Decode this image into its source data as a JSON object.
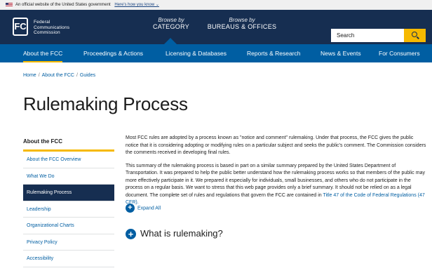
{
  "gov_banner": {
    "text": "An official website of the United States government",
    "link": "Here's how you know ⌄"
  },
  "masthead": {
    "logo_mark": "FC",
    "logo_lines": [
      "Federal",
      "Communications",
      "Commission"
    ],
    "browse_category": {
      "small": "Browse by",
      "big": "CATEGORY"
    },
    "browse_bureaus": {
      "small": "Browse by",
      "big": "BUREAUS & OFFICES"
    },
    "search_placeholder": "Search"
  },
  "nav": [
    {
      "label": "About the FCC",
      "active": true
    },
    {
      "label": "Proceedings & Actions",
      "active": false
    },
    {
      "label": "Licensing & Databases",
      "active": false
    },
    {
      "label": "Reports & Research",
      "active": false
    },
    {
      "label": "News & Events",
      "active": false
    },
    {
      "label": "For Consumers",
      "active": false
    }
  ],
  "breadcrumb": [
    "Home",
    "About the FCC",
    "Guides"
  ],
  "page_title": "Rulemaking Process",
  "sidebar": {
    "heading": "About the FCC",
    "items": [
      {
        "label": "About the FCC Overview",
        "active": false
      },
      {
        "label": "What We Do",
        "active": false
      },
      {
        "label": "Rulemaking Process",
        "active": true
      },
      {
        "label": "Leadership",
        "active": false
      },
      {
        "label": "Organizational Charts",
        "active": false
      },
      {
        "label": "Privacy Policy",
        "active": false
      },
      {
        "label": "Accessibility",
        "active": false
      }
    ]
  },
  "content": {
    "para1": "Most FCC rules are adopted by a process known as \"notice and comment\" rulemaking. Under that process, the FCC gives the public notice that it is considering adopting or modifying rules on a particular subject and seeks the public's comment. The Commission considers the comments received in developing final rules.",
    "para2": "This summary of the rulemaking process is based in part on a similar summary prepared by the United States Department of Transportation. It was prepared to help the public better understand how the rulemaking process works so that members of the public may more effectively participate in it. We prepared it especially for individuals, small businesses, and others who do not participate in the process on a regular basis. We want to stress that this web page provides only a brief summary. It should not be relied on as a legal document. The complete set of rules and regulations that govern the FCC are contained in",
    "cfr_link": "Title 47 of the Code of Federal Regulations (47 CFR).",
    "expand_all": "Expand All",
    "accordion_heading": "What is rulemaking?"
  },
  "colors": {
    "masthead": "#162e51",
    "nav": "#005ea2",
    "accent": "#f6b900",
    "link": "#005ea2"
  },
  "icons": {
    "seal": "flag-icon",
    "search": "search-icon",
    "expand": "plus-circle-icon"
  }
}
